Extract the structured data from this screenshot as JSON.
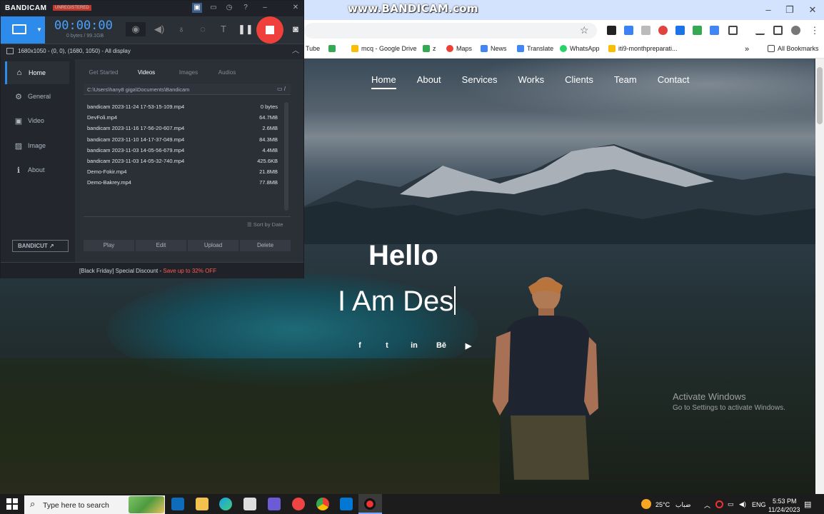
{
  "watermark": "www.BANDICAM.com",
  "browser": {
    "window_controls": [
      "–",
      "❐",
      "✕"
    ],
    "bookmarks": [
      {
        "label": "Tube",
        "color": "#ff0000"
      },
      {
        "label": "",
        "color": "#34a853"
      },
      {
        "label": "mcq - Google Drive",
        "color": "#fbbc04"
      },
      {
        "label": "z",
        "color": "#34a853"
      },
      {
        "label": "Maps",
        "color": "#ea4335"
      },
      {
        "label": "News",
        "color": "#4285f4"
      },
      {
        "label": "Translate",
        "color": "#4285f4"
      },
      {
        "label": "WhatsApp",
        "color": "#25d366"
      },
      {
        "label": "iti9-monthpreparati...",
        "color": "#fbbc04"
      }
    ],
    "bookmarks_more": "»",
    "all_bookmarks": "All Bookmarks"
  },
  "webpage": {
    "nav": [
      "Home",
      "About",
      "Services",
      "Works",
      "Clients",
      "Team",
      "Contact"
    ],
    "hello": "Hello",
    "typed": "I Am Des",
    "social": [
      "f",
      "t",
      "in",
      "Bē",
      "▶"
    ],
    "activate_title": "Activate Windows",
    "activate_sub": "Go to Settings to activate Windows."
  },
  "bandicam": {
    "logo": "BANDICAM",
    "badge": "UNREGISTERED",
    "timer": "00:00:00",
    "size": "0 bytes / 99.1GB",
    "area": "1680x1050 - (0, 0), (1680, 1050) - All display",
    "sidebar": [
      {
        "label": "Home",
        "icon": "home-icon",
        "glyph": "⌂"
      },
      {
        "label": "General",
        "icon": "gear-icon",
        "glyph": "⚙"
      },
      {
        "label": "Video",
        "icon": "video-icon",
        "glyph": "▣"
      },
      {
        "label": "Image",
        "icon": "image-icon",
        "glyph": "▨"
      },
      {
        "label": "About",
        "icon": "info-icon",
        "glyph": "ℹ"
      }
    ],
    "bandicut": "BANDICUT ↗",
    "tabs": [
      "Get Started",
      "Videos",
      "Images",
      "Audios"
    ],
    "path": "C:\\Users\\hany8 giga\\Documents\\Bandicam",
    "files": [
      {
        "name": "bandicam 2023-11-24 17-53-15-109.mp4",
        "size": "0 bytes"
      },
      {
        "name": "DevFoli.mp4",
        "size": "64.7MB"
      },
      {
        "name": "bandicam 2023-11-16 17-56-20-607.mp4",
        "size": "2.6MB"
      },
      {
        "name": "bandicam 2023-11-10 14-17-37-049.mp4",
        "size": "84.3MB"
      },
      {
        "name": "bandicam 2023-11-03 14-05-56-679.mp4",
        "size": "4.4MB"
      },
      {
        "name": "bandicam 2023-11-03 14-05-32-740.mp4",
        "size": "425.6KB"
      },
      {
        "name": "Demo-Fokir.mp4",
        "size": "21.8MB"
      },
      {
        "name": "Demo-Bakrey.mp4",
        "size": "77.8MB"
      }
    ],
    "sort": "☰ Sort by Date",
    "actions": [
      "Play",
      "Edit",
      "Upload",
      "Delete"
    ],
    "promo_prefix": "[Black Friday] Special Discount - ",
    "promo_highlight": "Save up to 32% OFF"
  },
  "taskbar": {
    "search_placeholder": "Type here to search",
    "weather": "25°C",
    "weather_desc": "ضباب",
    "lang": "ENG",
    "time": "5:53 PM",
    "date": "11/24/2023"
  }
}
